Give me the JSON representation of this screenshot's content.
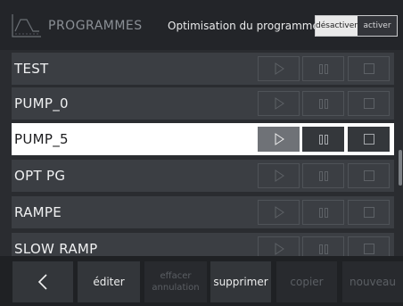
{
  "header": {
    "title": "PROGRAMMES",
    "logo_icon": "programme-chart-icon",
    "optimisation_label": "Optimisation du programme :",
    "toggle": {
      "disable_label": "désactiver",
      "enable_label": "activer",
      "selected": "désactiver"
    }
  },
  "programs": [
    {
      "name": "TEST",
      "selected": false
    },
    {
      "name": "PUMP_0",
      "selected": false
    },
    {
      "name": "PUMP_5",
      "selected": true
    },
    {
      "name": "OPT PG",
      "selected": false
    },
    {
      "name": "RAMPE",
      "selected": false
    },
    {
      "name": "SLOW RAMP",
      "selected": false
    }
  ],
  "row_controls": {
    "play_icon": "play-icon",
    "pause_icon": "pause-icon",
    "stop_icon": "stop-icon"
  },
  "footer": {
    "back_icon": "chevron-left-icon",
    "edit_label": "éditer",
    "clear_label_line1": "effacer",
    "clear_label_line2": "annulation",
    "delete_label": "supprimer",
    "copy_label": "copier",
    "new_label": "nouveau"
  },
  "colors": {
    "background": "#2a2c30",
    "row": "#3b3e43",
    "selected_row": "#ffffff",
    "footer": "#1f2124"
  }
}
